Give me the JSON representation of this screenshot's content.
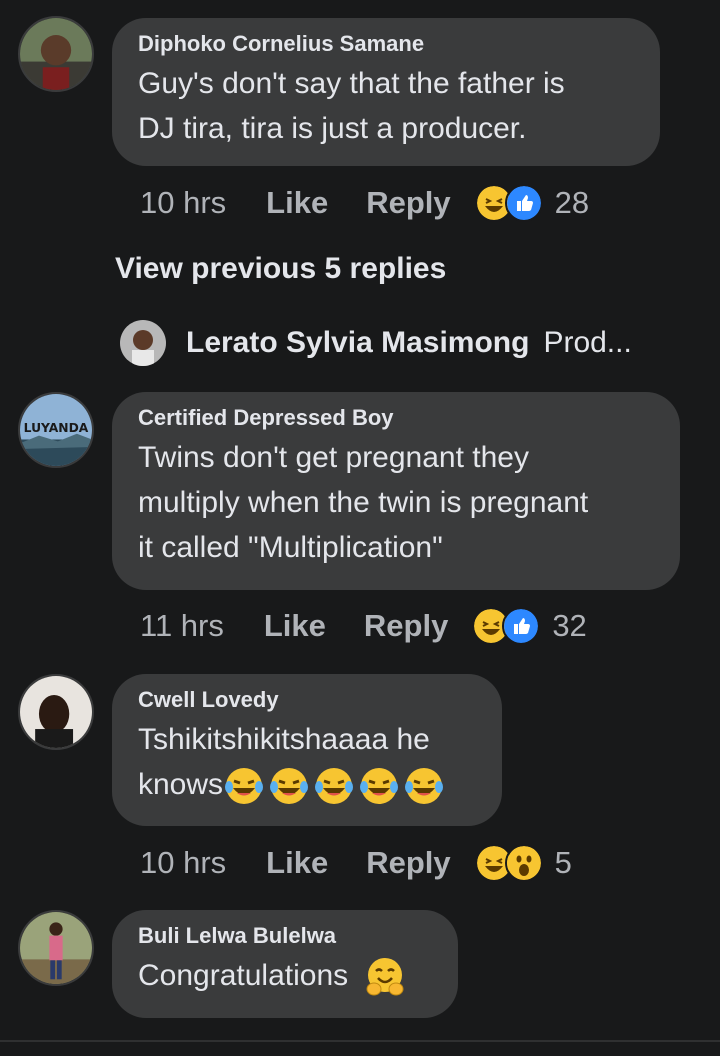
{
  "comments": [
    {
      "author": "Diphoko Cornelius Samane",
      "text_lines": [
        "Guy's  don't  say that the father is",
        "DJ tira, tira is just a producer."
      ],
      "time": "10 hrs",
      "like": "Like",
      "reply": "Reply",
      "reactions": [
        "haha-icon",
        "like-icon"
      ],
      "count": "28"
    },
    {
      "author": "Certified Depressed Boy",
      "avatar_text": "LUYANDA",
      "text_lines": [
        "Twins don't get pregnant they",
        "multiply when the twin is pregnant",
        "it called \"Multiplication\""
      ],
      "time": "11 hrs",
      "like": "Like",
      "reply": "Reply",
      "reactions": [
        "haha-icon",
        "like-icon"
      ],
      "count": "32"
    },
    {
      "author": "Cwell Lovedy",
      "text_lines": [
        "Tshikitshikitshaaaa he",
        "knows"
      ],
      "time": "10 hrs",
      "like": "Like",
      "reply": "Reply",
      "reactions": [
        "haha-icon",
        "wow-icon"
      ],
      "count": "5"
    },
    {
      "author": "Buli Lelwa Bulelwa",
      "text_lines": [
        "Congratulations"
      ]
    }
  ],
  "view_previous": "View previous 5 replies",
  "reply_preview": {
    "name": "Lerato Sylvia Masimong",
    "snippet": "Prod..."
  },
  "colors": {
    "background": "#18191a",
    "bubble": "#3a3b3c",
    "text": "#e4e6eb",
    "muted": "#b0b3b8"
  }
}
